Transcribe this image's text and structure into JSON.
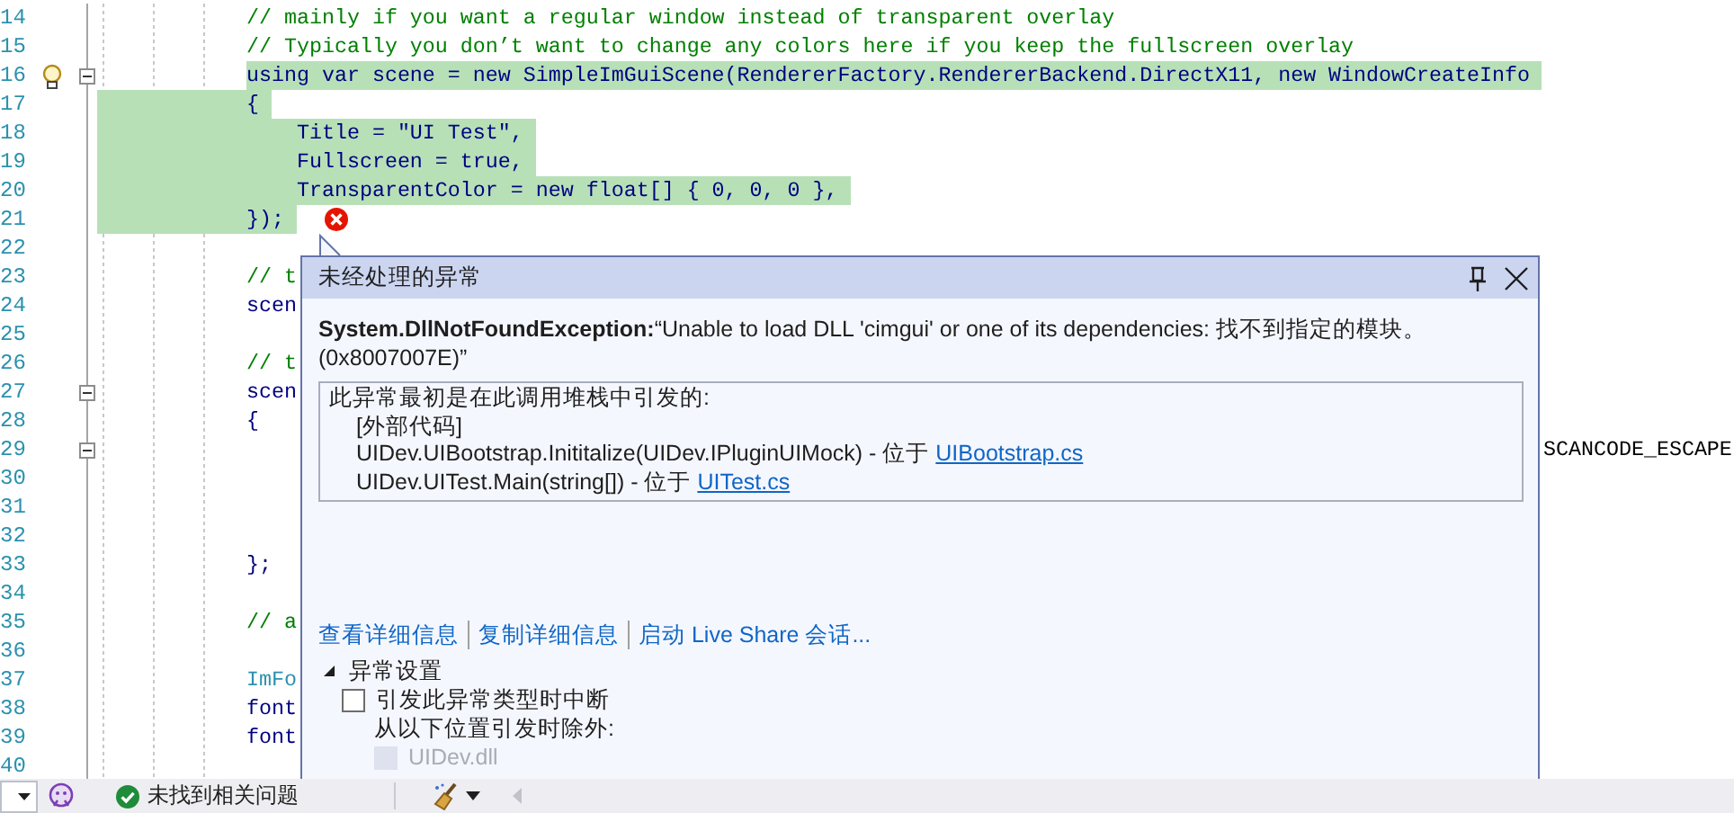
{
  "editor": {
    "lines": [
      {
        "number": "14",
        "text": "// mainly if you want a regular window instead of transparent overlay",
        "kind": "comment"
      },
      {
        "number": "15",
        "text": "// Typically you don’t want to change any colors here if you keep the fullscreen overlay",
        "kind": "comment"
      },
      {
        "number": "16",
        "text": "using var scene = new SimpleImGuiScene(RendererFactory.RendererBackend.DirectX11, new WindowCreateInfo",
        "kind": "code",
        "selected": true,
        "lightbulb": true,
        "expanded": true
      },
      {
        "number": "17",
        "text": "{",
        "kind": "code",
        "selected": true,
        "gutter_selected": true
      },
      {
        "number": "18",
        "text": "    Title = \"UI Test\",",
        "kind": "code",
        "selected": true,
        "gutter_selected": true
      },
      {
        "number": "19",
        "text": "    Fullscreen = true,",
        "kind": "code",
        "selected": true,
        "gutter_selected": true
      },
      {
        "number": "20",
        "text": "    TransparentColor = new float[] { 0, 0, 0 },",
        "kind": "code",
        "selected": true,
        "gutter_selected": true
      },
      {
        "number": "21",
        "text": "});",
        "kind": "code",
        "selected": true,
        "gutter_selected": true,
        "error": true
      },
      {
        "number": "22"
      },
      {
        "number": "23",
        "text": "// t",
        "kind": "comment"
      },
      {
        "number": "24",
        "text": "scen",
        "kind": "code"
      },
      {
        "number": "25"
      },
      {
        "number": "26",
        "text": "// t",
        "kind": "comment"
      },
      {
        "number": "27",
        "text": "scen",
        "kind": "code",
        "expanded": true
      },
      {
        "number": "28",
        "text": "{",
        "kind": "code"
      },
      {
        "number": "29",
        "expanded": true,
        "tail": "SCANCODE_ESCAPE"
      },
      {
        "number": "30"
      },
      {
        "number": "31"
      },
      {
        "number": "32"
      },
      {
        "number": "33",
        "text": "};",
        "kind": "code"
      },
      {
        "number": "34"
      },
      {
        "number": "35",
        "text": "// a",
        "kind": "comment"
      },
      {
        "number": "36"
      },
      {
        "number": "37",
        "text": "ImFo",
        "kind": "type"
      },
      {
        "number": "38",
        "text": "font",
        "kind": "code"
      },
      {
        "number": "39",
        "text": "font",
        "kind": "code"
      },
      {
        "number": "40"
      }
    ]
  },
  "exception_popup": {
    "title": "未经处理的异常",
    "message": "**System.DllNotFoundException:**“Unable to load DLL 'cimgui' or one of its dependencies: 找不到指定的模块。 (0x8007007E)”",
    "stack": {
      "heading": "此异常最初是在此调用堆栈中引发的:",
      "frames": [
        {
          "text": "[外部代码]"
        },
        {
          "text": "UIDev.UIBootstrap.Inititalize(UIDev.IPluginUIMock) - 位于 ",
          "link": "UIBootstrap.cs"
        },
        {
          "text": "UIDev.UITest.Main(string[]) - 位于 ",
          "link": "UITest.cs"
        }
      ]
    },
    "actions": [
      "查看详细信息",
      "复制详细信息",
      "启动 Live Share 会话..."
    ],
    "settings": {
      "heading": "异常设置",
      "expanded": true,
      "break_option": {
        "label": "引发此异常类型时中断",
        "checked": false
      },
      "except_label": "从以下位置引发时除外:",
      "modules": [
        {
          "label": "UIDev.dll",
          "checked": false,
          "disabled": true
        }
      ]
    }
  },
  "status_bar": {
    "issues": "未找到相关问题"
  }
}
